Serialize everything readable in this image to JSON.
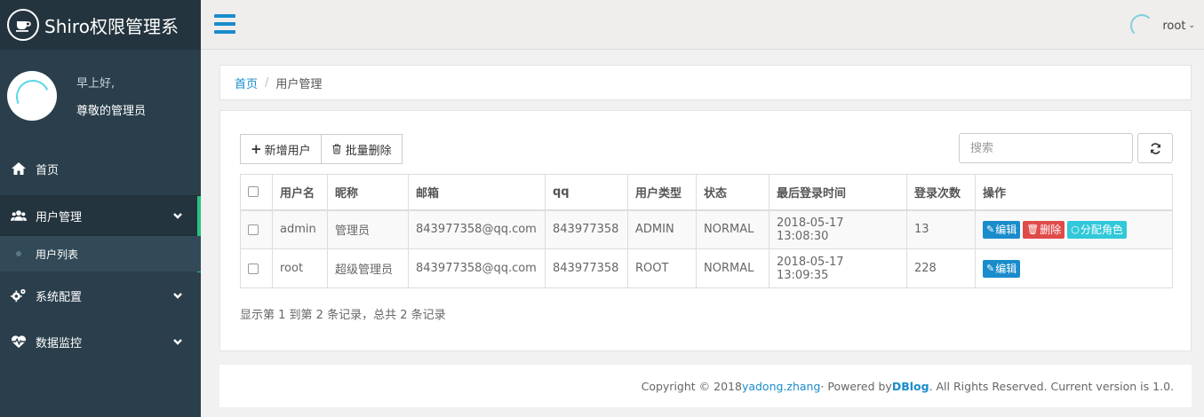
{
  "brand": {
    "title": "Shiro权限管理系"
  },
  "user_panel": {
    "greeting": "早上好,",
    "role": "尊敬的管理员"
  },
  "sidebar": {
    "items": [
      {
        "label": "首页",
        "icon": "home-icon"
      },
      {
        "label": "用户管理",
        "icon": "users-icon",
        "children": [
          {
            "label": "用户列表"
          }
        ]
      },
      {
        "label": "系统配置",
        "icon": "gears-icon"
      },
      {
        "label": "数据监控",
        "icon": "heartbeat-icon"
      }
    ]
  },
  "topbar": {
    "username": "root"
  },
  "breadcrumb": {
    "home": "首页",
    "current": "用户管理"
  },
  "toolbar": {
    "add_label": "新增用户",
    "batch_delete_label": "批量删除"
  },
  "search": {
    "placeholder": "搜索"
  },
  "table": {
    "headers": [
      "用户名",
      "昵称",
      "邮箱",
      "qq",
      "用户类型",
      "状态",
      "最后登录时间",
      "登录次数",
      "操作"
    ],
    "rows": [
      {
        "username": "admin",
        "nickname": "管理员",
        "email": "843977358@qq.com",
        "qq": "843977358",
        "type": "ADMIN",
        "status": "NORMAL",
        "last_login": "2018-05-17 13:08:30",
        "login_count": "13",
        "actions": [
          "编辑",
          "删除",
          "分配角色"
        ]
      },
      {
        "username": "root",
        "nickname": "超级管理员",
        "email": "843977358@qq.com",
        "qq": "843977358",
        "type": "ROOT",
        "status": "NORMAL",
        "last_login": "2018-05-17 13:09:35",
        "login_count": "228",
        "actions": [
          "编辑"
        ]
      }
    ]
  },
  "pagination": {
    "summary": "显示第 1 到第 2 条记录，总共 2 条记录"
  },
  "footer": {
    "copyright": "Copyright © 2018 ",
    "author": "yadong.zhang",
    "powered": " · Powered by ",
    "blog": "DBlog",
    "rights": ". All Rights Reserved. Current version is 1.0."
  },
  "colors": {
    "sidebar_bg": "#2a3f4b",
    "accent": "#1a8ccc",
    "active_bar": "#26c281",
    "danger": "#e04b4a",
    "info": "#31c8d9"
  }
}
